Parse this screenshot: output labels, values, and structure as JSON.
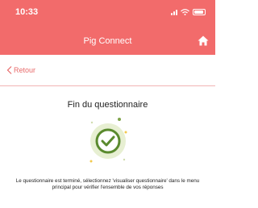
{
  "status_bar": {
    "time": "10:33"
  },
  "header": {
    "title": "Pig Connect",
    "home_icon": "home-icon"
  },
  "navigation": {
    "back_label": "Retour",
    "back_icon": "chevron-left-icon"
  },
  "main": {
    "title": "Fin du questionnaire",
    "illustration_icon": "check-circle-icon",
    "message": "Le questionnaire est terminé, sélectionnez 'visualiser questionnaire' dans le menu principal pour vérifier l'ensemble de vos réponses"
  },
  "colors": {
    "brand": "#f26b6b",
    "accent_green": "#5a8a2e",
    "light_green": "#e7efd2",
    "dot_yellow": "#f2c94c"
  }
}
